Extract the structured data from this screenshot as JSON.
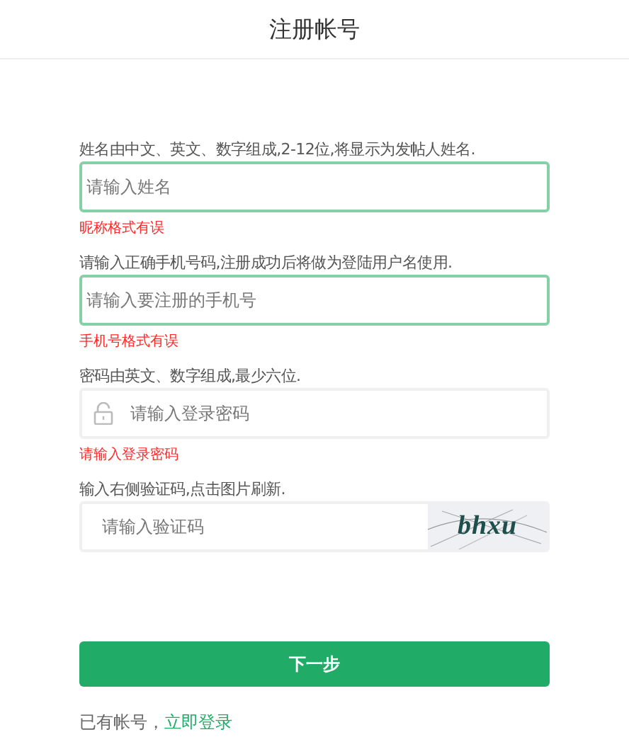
{
  "header": {
    "title": "注册帐号"
  },
  "fields": [
    {
      "kind": "text",
      "label": "姓名由中文、英文、数字组成,2-12位,将显示为发帖人姓名.",
      "placeholder": "请输入姓名",
      "highlighted": true,
      "error": "昵称格式有误"
    },
    {
      "kind": "text",
      "label": "请输入正确手机号码,注册成功后将做为登陆用户名使用.",
      "placeholder": "请输入要注册的手机号",
      "highlighted": true,
      "error": "手机号格式有误"
    },
    {
      "kind": "password",
      "label": "密码由英文、数字组成,最少六位.",
      "placeholder": "请输入登录密码",
      "highlighted": false,
      "error": "请输入登录密码"
    },
    {
      "kind": "captcha",
      "label": "输入右侧验证码,点击图片刷新.",
      "placeholder": "请输入验证码",
      "highlighted": false,
      "captcha_text": "bhxu"
    }
  ],
  "submit": {
    "label": "下一步"
  },
  "footer": {
    "text": "已有帐号，",
    "link": "立即登录"
  }
}
